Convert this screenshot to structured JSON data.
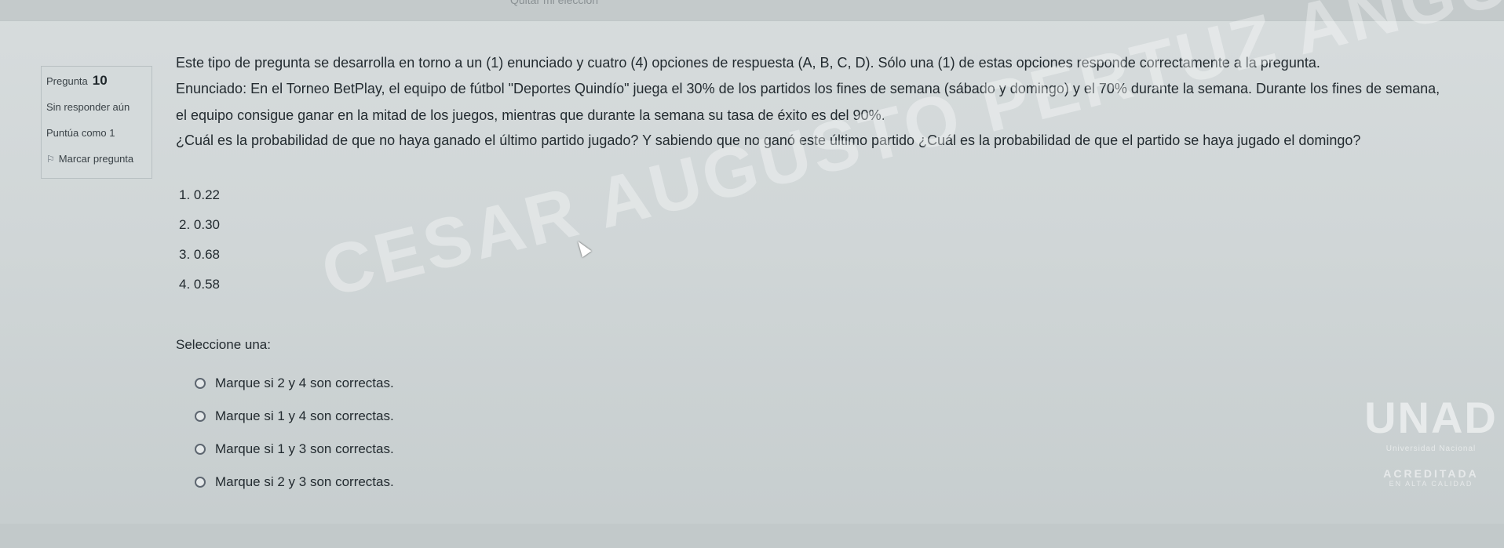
{
  "browser": {
    "top_text": "Quitar mi elección"
  },
  "info": {
    "question_label": "Pregunta",
    "question_number": "10",
    "status": "Sin responder aún",
    "score": "Puntúa como 1",
    "flag_label": "Marcar pregunta"
  },
  "question": {
    "intro": "Este tipo de pregunta se desarrolla en torno a un (1) enunciado y cuatro (4) opciones de respuesta (A, B, C, D). Sólo una (1) de estas opciones responde correctamente a la pregunta.",
    "enunciado": "Enunciado: En el Torneo BetPlay, el equipo de fútbol \"Deportes Quindío\" juega el 30% de los partidos los fines de semana (sábado y domingo) y el 70% durante la semana. Durante los fines de semana, el equipo consigue ganar en la mitad de los juegos, mientras que durante la semana su tasa de éxito es del 90%.",
    "text": "¿Cuál es la probabilidad de que no haya ganado el último partido jugado? Y sabiendo que no ganó este último partido ¿Cuál es la probabilidad de que el partido se haya jugado el domingo?",
    "numbered": [
      "1. 0.22",
      "2. 0.30",
      "3. 0.68",
      "4. 0.58"
    ]
  },
  "answer": {
    "select_label": "Seleccione una:",
    "options": [
      "Marque si 2 y 4 son correctas.",
      "Marque si 1 y 4 son correctas.",
      "Marque si 1 y 3 son correctas.",
      "Marque si 2 y 3 son correctas."
    ]
  },
  "watermark": "CESAR AUGUSTO PERTUZ ANGULO",
  "logo": {
    "mark": "UNAD",
    "subtitle": "Universidad Nacional",
    "accreditation": "ACREDITADA",
    "accreditation_sub": "EN ALTA CALIDAD"
  },
  "icons": {
    "flag": "flag-icon",
    "radio": "radio-icon",
    "cursor": "mouse-cursor-icon"
  }
}
